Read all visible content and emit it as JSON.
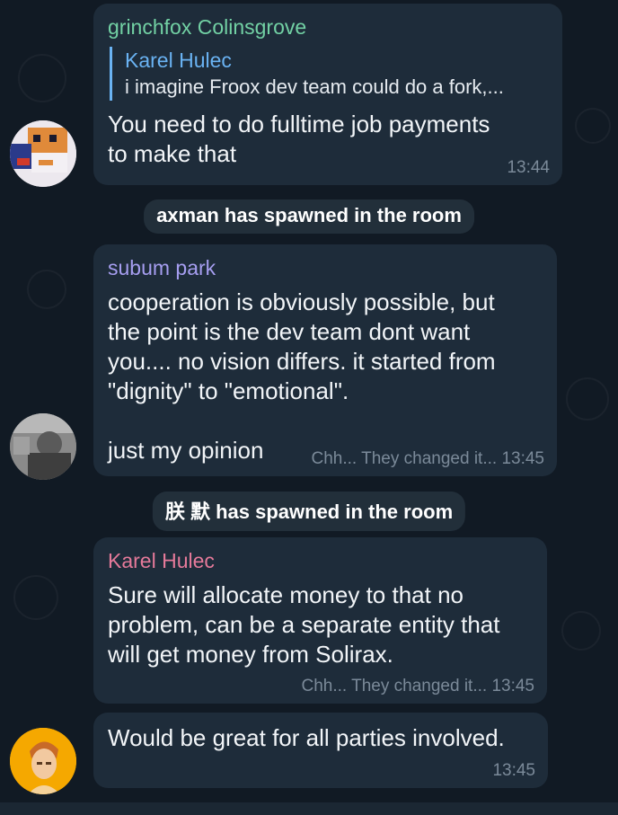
{
  "messages": [
    {
      "sender": "grinchfox Colinsgrove",
      "sender_color": "#72d1a4",
      "reply": {
        "name": "Karel Hulec",
        "text": "i imagine Froox dev team could do a fork,..."
      },
      "text": "You need to do fulltime job payments\nto make that",
      "time": "13:44"
    },
    {
      "sender": "subum park",
      "sender_color": "#a69ef0",
      "text": "cooperation is obviously possible, but\nthe point is the dev team dont want\nyou.... no vision differs. it started from\n\"dignity\" to \"emotional\".\n\njust my opinion",
      "signature": "Chh... They changed it...",
      "time": "13:45"
    },
    {
      "sender": "Karel Hulec",
      "sender_color": "#e57a9a",
      "text": "Sure will allocate money to that no\nproblem, can be a separate entity that\nwill get money from Solirax.",
      "signature": "Chh... They changed it...",
      "time": "13:45"
    },
    {
      "text": "Would be great for all parties involved.",
      "time": "13:45"
    }
  ],
  "service_messages": [
    "axman has spawned in the room",
    "朕 默 has spawned in the room"
  ],
  "colors": {
    "background": "#111a24",
    "bubble": "#1e2c3a",
    "reply_accent": "#6ab3f3",
    "meta": "#7b8a99"
  }
}
